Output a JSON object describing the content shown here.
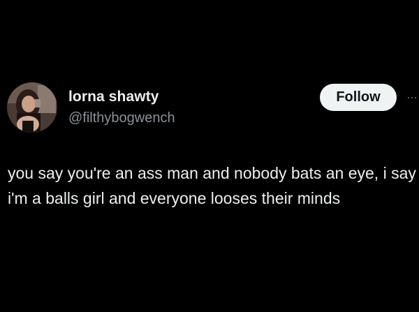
{
  "post": {
    "author": {
      "display_name": "lorna shawty",
      "handle": "@filthybogwench",
      "avatar_icon": "profile-photo"
    },
    "follow_label": "Follow",
    "more_icon": "more-options-icon",
    "text": "you say you're an ass man and nobody bats an eye, i say i'm a balls girl and everyone looses their minds"
  },
  "colors": {
    "background": "#000000",
    "primary_text": "#eceff1",
    "secondary_text": "#8b9198",
    "follow_button_bg": "#eff3f4",
    "follow_button_text": "#0f1419"
  }
}
